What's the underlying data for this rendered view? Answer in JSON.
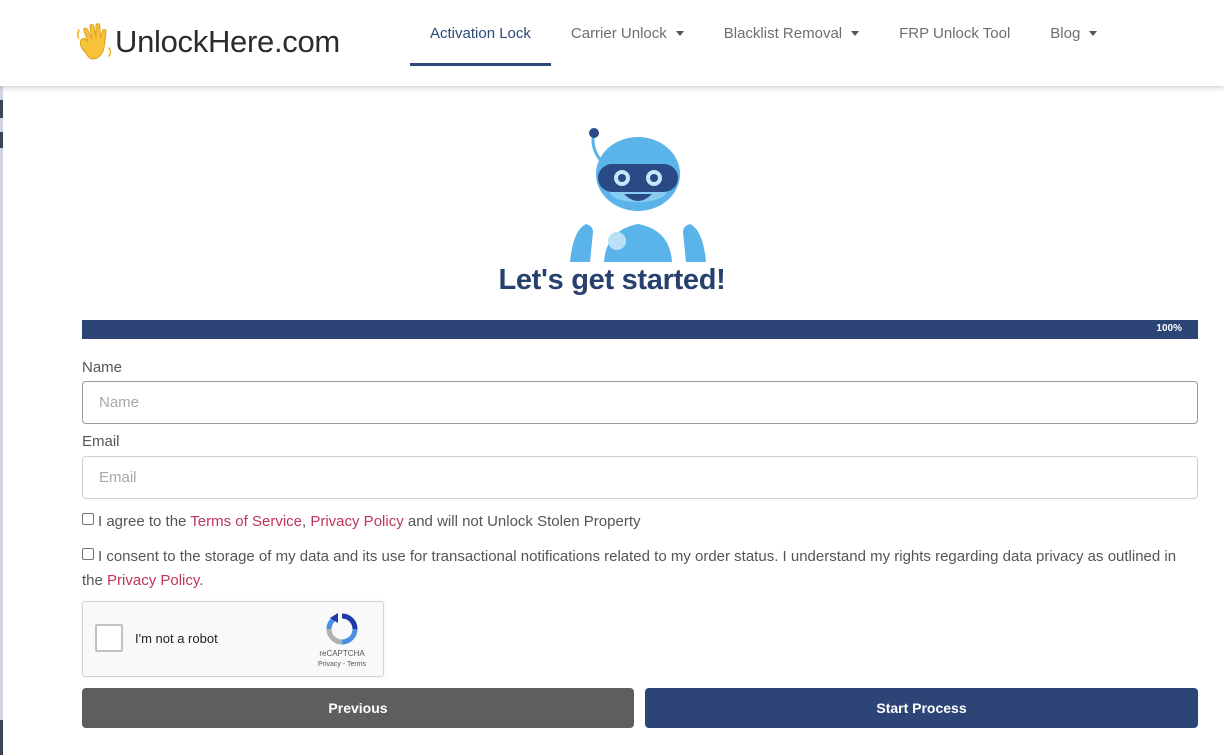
{
  "header": {
    "logo_text": "UnlockHere.com",
    "logo_icon": "waving-hand-icon",
    "nav": [
      {
        "label": "Activation Lock",
        "active": true,
        "dropdown": false
      },
      {
        "label": "Carrier Unlock",
        "active": false,
        "dropdown": true
      },
      {
        "label": "Blacklist Removal",
        "active": false,
        "dropdown": true
      },
      {
        "label": "FRP Unlock Tool",
        "active": false,
        "dropdown": false
      },
      {
        "label": "Blog",
        "active": false,
        "dropdown": true
      }
    ]
  },
  "hero": {
    "illustration": "robot-icon",
    "title": "Let's get started!"
  },
  "progress": {
    "percent": 100,
    "label": "100%"
  },
  "form": {
    "name_label": "Name",
    "name_placeholder": "Name",
    "name_value": "",
    "email_label": "Email",
    "email_placeholder": "Email",
    "email_value": "",
    "terms": {
      "checked": false,
      "prefix": "I agree to the ",
      "link1": "Terms of Service",
      "sep": ", ",
      "link2": "Privacy Policy",
      "suffix": " and will not Unlock Stolen Property"
    },
    "consent": {
      "checked": false,
      "prefix": "I consent to the storage of my data and its use for transactional notifications related to my order status. I understand my rights regarding data privacy as outlined in the ",
      "link": "Privacy Policy",
      "suffix": "."
    }
  },
  "recaptcha": {
    "label": "I'm not a robot",
    "brand": "reCAPTCHA",
    "links": "Privacy - Terms"
  },
  "buttons": {
    "previous": "Previous",
    "start": "Start Process"
  },
  "colors": {
    "brand_navy": "#2c4476",
    "title_navy": "#27406e",
    "link_red": "#c0355a",
    "robot_blue": "#5ab4ea",
    "prev_gray": "#5e5e5e"
  }
}
